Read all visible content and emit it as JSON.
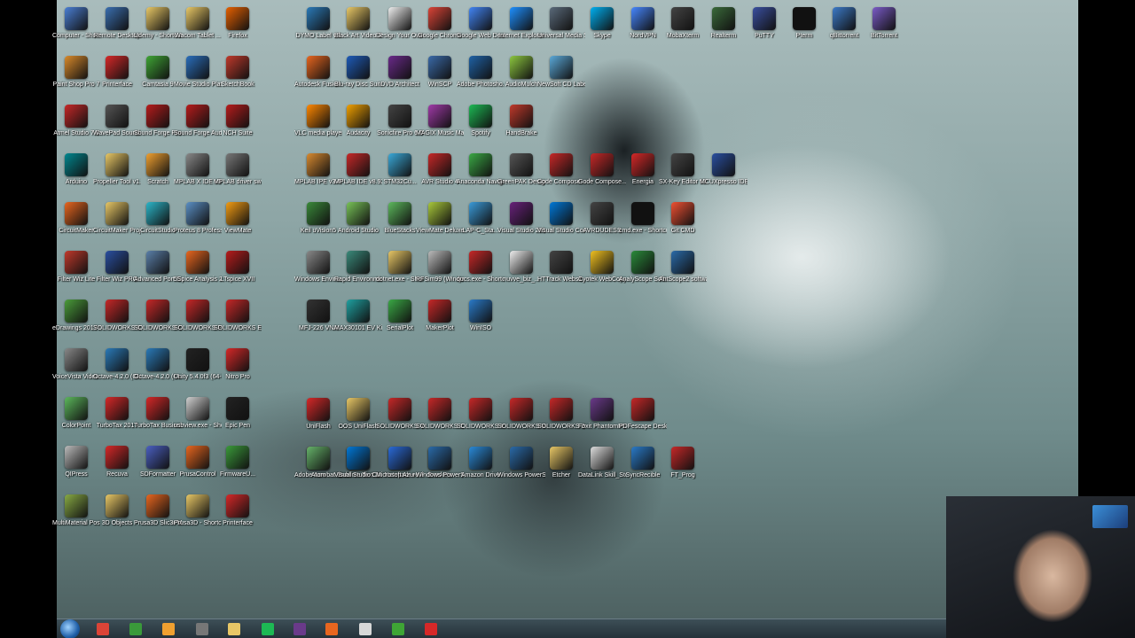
{
  "desktop_icons": [
    {
      "label": "Computer - Shortcut",
      "color": "#4a7fd4",
      "icon": "computer-icon"
    },
    {
      "label": "Remote Desktop",
      "color": "#3a6fb0",
      "icon": "remote-desktop-icon"
    },
    {
      "label": "Udemy - Shortcut",
      "color": "#e8c766",
      "icon": "folder-icon"
    },
    {
      "label": "Wacom Tablet ...",
      "color": "#e8c766",
      "icon": "folder-icon"
    },
    {
      "label": "Firefox",
      "color": "#e66000",
      "icon": "firefox-icon"
    },
    {
      "label": "Paint Shop Pro 7",
      "color": "#d98a2b",
      "icon": "paint-icon"
    },
    {
      "label": "Printerface",
      "color": "#d62828",
      "icon": "printerface-icon"
    },
    {
      "label": "Camtasia 9",
      "color": "#3fa535",
      "icon": "camtasia-icon"
    },
    {
      "label": "Movie Studio Platinum 14.0",
      "color": "#2a6ebb",
      "icon": "movie-icon"
    },
    {
      "label": "SketchBook",
      "color": "#c0392b",
      "icon": "sketchbook-icon"
    },
    {
      "label": "Atmel Studio 7.0",
      "color": "#c62828",
      "icon": "atmel-icon"
    },
    {
      "label": "WavePad Sound Editor",
      "color": "#555555",
      "icon": "wavepad-icon"
    },
    {
      "label": "Sound Forge Pro 11.0",
      "color": "#b71c1c",
      "icon": "soundforge-icon"
    },
    {
      "label": "Sound Forge Audio Studio",
      "color": "#b71c1c",
      "icon": "soundforge-icon"
    },
    {
      "label": "NCH Suite",
      "color": "#b71c1c",
      "icon": "nch-icon"
    },
    {
      "label": "Arduino",
      "color": "#00878f",
      "icon": "arduino-icon"
    },
    {
      "label": "Propeller Tool v1.3.2",
      "color": "#e8c766",
      "icon": "propeller-icon"
    },
    {
      "label": "Scratch",
      "color": "#f0a030",
      "icon": "scratch-icon"
    },
    {
      "label": "MPLAB X IDE v3.45",
      "color": "#888888",
      "icon": "mplab-icon"
    },
    {
      "label": "MPLAB driver switcher",
      "color": "#777777",
      "icon": "mplab-driver-icon"
    },
    {
      "label": "CircuitMaker",
      "color": "#e8661f",
      "icon": "circuitmaker-icon"
    },
    {
      "label": "CircuitMaker Projects",
      "color": "#e8c766",
      "icon": "folder-icon"
    },
    {
      "label": "CircuitStudio",
      "color": "#2bb5c8",
      "icon": "circuitstudio-icon"
    },
    {
      "label": "Proteus 8 Professional",
      "color": "#5a8fc4",
      "icon": "proteus-icon"
    },
    {
      "label": "ViewMate",
      "color": "#f39c12",
      "icon": "viewmate-icon"
    },
    {
      "label": "Filter Wiz Lite",
      "color": "#c0392b",
      "icon": "filter-icon"
    },
    {
      "label": "Filter Wiz PRO",
      "color": "#2a4fa0",
      "icon": "filter-icon"
    },
    {
      "label": "Advanced Port Scanner",
      "color": "#5a7fa8",
      "icon": "scanner-icon"
    },
    {
      "label": "5Spice Analysis 2.0",
      "color": "#e8661f",
      "icon": "spice-icon"
    },
    {
      "label": "LTspice XVII",
      "color": "#b71c1c",
      "icon": "ltspice-icon"
    },
    {
      "label": "eDrawings 2017 x64...",
      "color": "#4a9c3a",
      "icon": "edrawings-icon"
    },
    {
      "label": "SOLIDWORKS Composer...",
      "color": "#c62828",
      "icon": "solidworks-icon"
    },
    {
      "label": "SOLIDWORKS Composer...",
      "color": "#c62828",
      "icon": "solidworks-icon"
    },
    {
      "label": "SOLIDWORKS PCB 2017",
      "color": "#c62828",
      "icon": "solidworks-icon"
    },
    {
      "label": "SOLIDWORKS Explorer 2017",
      "color": "#c62828",
      "icon": "solidworks-icon"
    },
    {
      "label": "VoiceVista Video Pro",
      "color": "#888888",
      "icon": "voicevista-icon"
    },
    {
      "label": "Octave-4.2.0 (GUI)",
      "color": "#2a7ab8",
      "icon": "octave-icon"
    },
    {
      "label": "Octave-4.2.0 (CLI)",
      "color": "#2a7ab8",
      "icon": "octave-icon"
    },
    {
      "label": "Unity 5.4.0f3 (64-bit)",
      "color": "#222222",
      "icon": "unity-icon"
    },
    {
      "label": "Nitro Pro",
      "color": "#d62828",
      "icon": "nitro-icon"
    },
    {
      "label": "ColorPoint",
      "color": "#5cb85c",
      "icon": "colorpoint-icon"
    },
    {
      "label": "TurboTax 2017",
      "color": "#d62828",
      "icon": "turbotax-icon"
    },
    {
      "label": "TurboTax Business 2017",
      "color": "#d62828",
      "icon": "turbotax-icon"
    },
    {
      "label": "usbview.exe - Shortcut",
      "color": "#d0d0d0",
      "icon": "usb-icon"
    },
    {
      "label": "Epic Pen",
      "color": "#222222",
      "icon": "epicpen-icon"
    },
    {
      "label": "QIPress",
      "color": "#bbbbbb",
      "icon": "qipress-icon"
    },
    {
      "label": "Recuva",
      "color": "#d62828",
      "icon": "recuva-icon"
    },
    {
      "label": "SDFormatter",
      "color": "#4a5fc1",
      "icon": "sdformatter-icon"
    },
    {
      "label": "PrusaControl",
      "color": "#e8661f",
      "icon": "prusa-icon"
    },
    {
      "label": "FirmwareU...",
      "color": "#3a9a3a",
      "icon": "firmware-icon"
    },
    {
      "label": "MultiMaterial PostProces...",
      "color": "#88aa44",
      "icon": "multimaterial-icon"
    },
    {
      "label": "3D Objects",
      "color": "#e8c766",
      "icon": "folder-icon"
    },
    {
      "label": "Prusa3D Slic3r MK2",
      "color": "#e8661f",
      "icon": "slic3r-icon"
    },
    {
      "label": "Prusa3D - Shortcut",
      "color": "#e8c766",
      "icon": "folder-icon"
    },
    {
      "label": "Printerface",
      "color": "#d62828",
      "icon": "printerface-icon"
    },
    {
      "label": "DYMO Label v.8",
      "color": "#2b7ab8",
      "icon": "dymo-icon"
    },
    {
      "label": "Black Art Video Ga...",
      "color": "#e8c766",
      "icon": "folder-icon"
    },
    {
      "label": "Design Your Own Video...",
      "color": "#eeeeee",
      "icon": "document-icon"
    },
    {
      "label": "Google Chrome",
      "color": "#db4437",
      "icon": "chrome-icon"
    },
    {
      "label": "Google Web Designer",
      "color": "#4285f4",
      "icon": "webdesigner-icon"
    },
    {
      "label": "Internet Explorer",
      "color": "#1e90ff",
      "icon": "ie-icon"
    },
    {
      "label": "Universal Media Server",
      "color": "#5a6a7a",
      "icon": "ums-icon"
    },
    {
      "label": "Skype",
      "color": "#00aff0",
      "icon": "skype-icon"
    },
    {
      "label": "NordVPN",
      "color": "#4687ff",
      "icon": "nordvpn-icon"
    },
    {
      "label": "MobaXterm",
      "color": "#444444",
      "icon": "mobaxterm-icon"
    },
    {
      "label": "Realterm",
      "color": "#3a6a3a",
      "icon": "realterm-icon"
    },
    {
      "label": "PuTTY",
      "color": "#3a4fa0",
      "icon": "putty-icon"
    },
    {
      "label": "Pterm",
      "color": "#111111",
      "icon": "pterm-icon"
    },
    {
      "label": "qBittorrent",
      "color": "#3c7ac8",
      "icon": "qbittorrent-icon"
    },
    {
      "label": "BitTorrent",
      "color": "#7b5bc7",
      "icon": "bittorrent-icon"
    },
    {
      "label": "Autodesk Fusion 360",
      "color": "#e8661f",
      "icon": "fusion-icon"
    },
    {
      "label": "Blu-ray Disc Suite",
      "color": "#1e5bb8",
      "icon": "bluray-icon"
    },
    {
      "label": "DVD Architect",
      "color": "#6a2a8a",
      "icon": "dvd-icon"
    },
    {
      "label": "WinSCP",
      "color": "#3a6aa8",
      "icon": "winscp-icon"
    },
    {
      "label": "Adobe Photosho...",
      "color": "#1f62a6",
      "icon": "photoshop-icon"
    },
    {
      "label": "AudioMulch",
      "color": "#8cc63f",
      "icon": "audiomulch-icon"
    },
    {
      "label": "NewSoft CD Labeler",
      "color": "#5aa8d8",
      "icon": "cdlabeler-icon"
    },
    {
      "label": "VLC media player",
      "color": "#ff8800",
      "icon": "vlc-icon"
    },
    {
      "label": "Audacity",
      "color": "#f0a000",
      "icon": "audacity-icon"
    },
    {
      "label": "Sonicfire Pro 6.0",
      "color": "#444444",
      "icon": "sonicfire-icon"
    },
    {
      "label": "MAGIX Music Maker",
      "color": "#a03aa8",
      "icon": "magix-icon"
    },
    {
      "label": "Spotify",
      "color": "#1db954",
      "icon": "spotify-icon"
    },
    {
      "label": "HandBrake",
      "color": "#c0392b",
      "icon": "handbrake-icon"
    },
    {
      "label": "MPLAB IPE v3.45",
      "color": "#d88a30",
      "icon": "mplab-icon"
    },
    {
      "label": "MPLAB IDE v8.92",
      "color": "#c62828",
      "icon": "mplab-icon"
    },
    {
      "label": "STM32Cu...",
      "color": "#3aa8d8",
      "icon": "stm32-icon"
    },
    {
      "label": "AVR Studio 4",
      "color": "#c62828",
      "icon": "avr-icon"
    },
    {
      "label": "Anaconda Navigator",
      "color": "#3aa845",
      "icon": "anaconda-icon"
    },
    {
      "label": "GreenPAK Designe...",
      "color": "#555555",
      "icon": "greenpak-icon"
    },
    {
      "label": "Code Compose...",
      "color": "#c62828",
      "icon": "ccs-icon"
    },
    {
      "label": "Gode Compose...",
      "color": "#c62828",
      "icon": "ccs-icon"
    },
    {
      "label": "Energia",
      "color": "#d62828",
      "icon": "energia-icon"
    },
    {
      "label": "SX-Key Editor v3.3.0",
      "color": "#444444",
      "icon": "sxkey-icon"
    },
    {
      "label": "MCUXpresso IDE v10.1.1...",
      "color": "#2a4fa0",
      "icon": "mcuxpresso-icon"
    },
    {
      "label": "Keil uVision5",
      "color": "#3a8a3a",
      "icon": "keil-icon"
    },
    {
      "label": "Android Studio",
      "color": "#78c257",
      "icon": "android-icon"
    },
    {
      "label": "BlueStacks",
      "color": "#5cb85c",
      "icon": "bluestacks-icon"
    },
    {
      "label": "ViewMate Deluxe",
      "color": "#a8c83a",
      "icon": "viewmate-icon"
    },
    {
      "label": "LAP-C_Sta...",
      "color": "#3a9ad8",
      "icon": "lapc-icon"
    },
    {
      "label": "Visual Studio 2015",
      "color": "#68217a",
      "icon": "visualstudio-icon"
    },
    {
      "label": "Visual Studio Code",
      "color": "#0078d7",
      "icon": "vscode-icon"
    },
    {
      "label": "AVRDUDESS",
      "color": "#444444",
      "icon": "avrdudess-icon"
    },
    {
      "label": "cmd.exe - Shortcut",
      "color": "#111111",
      "icon": "cmd-icon"
    },
    {
      "label": "Git CMD",
      "color": "#f05033",
      "icon": "git-icon"
    },
    {
      "label": "Windows Environme...",
      "color": "#888888",
      "icon": "tools-icon"
    },
    {
      "label": "Rapid Environme...",
      "color": "#3a8a7a",
      "icon": "rapid-icon"
    },
    {
      "label": "dotnet.exe - Shortcut",
      "color": "#e8c766",
      "icon": "dotnet-icon"
    },
    {
      "label": "RFSim99 (Windows ...",
      "color": "#bbbbbb",
      "icon": "rfsim-icon"
    },
    {
      "label": "qucs.exe - Shortcut",
      "color": "#c62828",
      "icon": "qucs-icon"
    },
    {
      "label": "nuvve_biz_...",
      "color": "#eeeeee",
      "icon": "document-icon"
    },
    {
      "label": "HTTrack Websit...",
      "color": "#444444",
      "icon": "httrack-icon"
    },
    {
      "label": "Cyotek WebCopy",
      "color": "#f0c020",
      "icon": "webcopy-icon"
    },
    {
      "label": "AnalyScope Software",
      "color": "#2a8a3a",
      "icon": "scope-icon"
    },
    {
      "label": "AntScope2 software",
      "color": "#2a6aa8",
      "icon": "antscope-icon"
    },
    {
      "label": "MFJ-226 VNA",
      "color": "#333333",
      "icon": "vna-icon"
    },
    {
      "label": "MAX30101 EV Kit Software",
      "color": "#1fa0a0",
      "icon": "maxim-icon"
    },
    {
      "label": "SerialPlot",
      "color": "#3aa845",
      "icon": "serialplot-icon"
    },
    {
      "label": "MakerPlot",
      "color": "#c62828",
      "icon": "makerplot-icon"
    },
    {
      "label": "WinISO",
      "color": "#2a7ac8",
      "icon": "winiso-icon"
    },
    {
      "label": "UniFlash",
      "color": "#d62828",
      "icon": "uniflash-icon"
    },
    {
      "label": "OOS UniFlash",
      "color": "#e8c766",
      "icon": "folder-icon"
    },
    {
      "label": "SOLIDWORKS Visualize 2017",
      "color": "#c62828",
      "icon": "solidworks-icon"
    },
    {
      "label": "SOLIDWORKS Composer...",
      "color": "#c62828",
      "icon": "solidworks-icon"
    },
    {
      "label": "SOLIDWORKS Inspection...",
      "color": "#c62828",
      "icon": "solidworks-icon"
    },
    {
      "label": "SOLIDWORKS Visualize Bo...",
      "color": "#c62828",
      "icon": "solidworks-icon"
    },
    {
      "label": "SOLIDWORKS 2017",
      "color": "#c62828",
      "icon": "solidworks-icon"
    },
    {
      "label": "Foxit PhantomPDF",
      "color": "#6a3a8a",
      "icon": "foxit-icon"
    },
    {
      "label": "PDFescape Desktop",
      "color": "#c62828",
      "icon": "pdfescape-icon"
    },
    {
      "label": "Adobe Acrobat DC",
      "color": "#c62828",
      "icon": "acrobat-icon"
    },
    {
      "label": "Sublime Text 3",
      "color": "#f0a030",
      "icon": "sublime-icon"
    },
    {
      "label": "Notepad++",
      "color": "#8cc63f",
      "icon": "notepadpp-icon"
    },
    {
      "label": "Brackets",
      "color": "#2a7ac8",
      "icon": "brackets-icon"
    },
    {
      "label": "Atom",
      "color": "#66b36a",
      "icon": "atom-icon"
    },
    {
      "label": "Visual Studio Code",
      "color": "#0078d7",
      "icon": "vscode-icon"
    },
    {
      "label": "Microsoft Azure Po...",
      "color": "#2a6ad8",
      "icon": "azure-icon"
    },
    {
      "label": "Windows PowerSh...",
      "color": "#2a6aa8",
      "icon": "powershell-icon"
    },
    {
      "label": "Amazon Drive",
      "color": "#2a8ad8",
      "icon": "amazondrive-icon"
    },
    {
      "label": "Windows PowerShell",
      "color": "#2a6aa8",
      "icon": "powershell-icon"
    },
    {
      "label": "Etcher",
      "color": "#e8c766",
      "icon": "etcher-icon"
    },
    {
      "label": "DataLink Skill_Sto...",
      "color": "#dddddd",
      "icon": "datalink-icon"
    },
    {
      "label": "SyncRecible",
      "color": "#2a7ac8",
      "icon": "sync-icon"
    },
    {
      "label": "FT_Prog",
      "color": "#c62828",
      "icon": "ftprog-icon"
    }
  ],
  "taskbar": {
    "items": [
      {
        "name": "chrome",
        "color": "#db4437"
      },
      {
        "name": "excel",
        "color": "#3a9a3a"
      },
      {
        "name": "sublime-text",
        "color": "#f0a030"
      },
      {
        "name": "tool",
        "color": "#777777"
      },
      {
        "name": "file-explorer",
        "color": "#e8c766"
      },
      {
        "name": "spotify",
        "color": "#1db954"
      },
      {
        "name": "foxit",
        "color": "#6a3a8a"
      },
      {
        "name": "circuitmaker",
        "color": "#e8661f"
      },
      {
        "name": "paint",
        "color": "#d8d8d8"
      },
      {
        "name": "camtasia",
        "color": "#3fa535"
      },
      {
        "name": "camtasia-recorder",
        "color": "#d62828"
      }
    ]
  }
}
